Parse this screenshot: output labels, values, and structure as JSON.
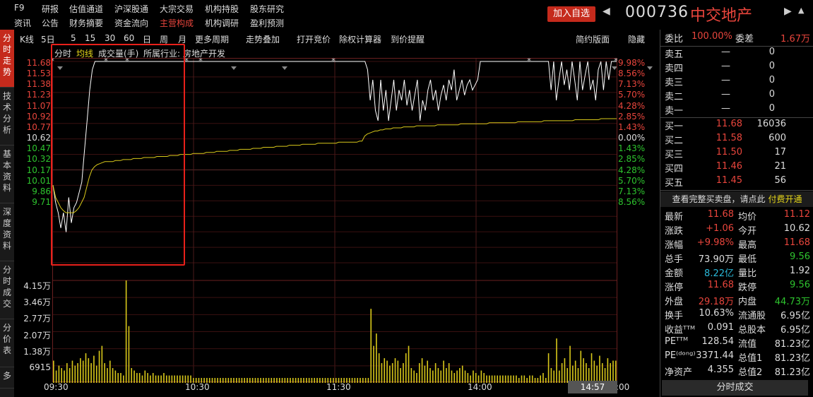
{
  "topnav": {
    "row1": [
      "F9",
      "研报",
      "估值通道",
      "沪深股通",
      "大宗交易",
      "机构持股",
      "股东研究"
    ],
    "row2": [
      "资讯",
      "公告",
      "财务摘要",
      "资金流向",
      "主营构成",
      "机构调研",
      "盈利预测"
    ],
    "active": "主营构成"
  },
  "header": {
    "add_watch": "加入自选",
    "code": "000736",
    "name": "中交地产"
  },
  "lefttabs": [
    "分时走势",
    "技术分析",
    "基本资料",
    "深度资料",
    "分时成交",
    "分价表",
    "多"
  ],
  "toolbar": {
    "items": [
      "K线",
      "5日",
      "5",
      "15",
      "30",
      "60",
      "日",
      "周",
      "月",
      "更多周期",
      "走势叠加",
      "打开竞价",
      "除权计算器",
      "到价提醒"
    ],
    "right": [
      "简约版面",
      "隐藏"
    ]
  },
  "subtabs": [
    "分时",
    "均线",
    "成交量(手)",
    "所属行业:",
    "房地产开发"
  ],
  "price_axis": {
    "left": [
      {
        "v": "11.68",
        "c": "red"
      },
      {
        "v": "11.53",
        "c": "red"
      },
      {
        "v": "11.38",
        "c": "red"
      },
      {
        "v": "11.23",
        "c": "red"
      },
      {
        "v": "11.07",
        "c": "red"
      },
      {
        "v": "10.92",
        "c": "red"
      },
      {
        "v": "10.77",
        "c": "red"
      },
      {
        "v": "10.62",
        "c": "white"
      },
      {
        "v": "10.47",
        "c": "green"
      },
      {
        "v": "10.32",
        "c": "green"
      },
      {
        "v": "10.17",
        "c": "green"
      },
      {
        "v": "10.01",
        "c": "green"
      },
      {
        "v": "9.86",
        "c": "green"
      },
      {
        "v": "9.71",
        "c": "green"
      }
    ],
    "right": [
      {
        "v": "9.98%",
        "c": "red"
      },
      {
        "v": "8.56%",
        "c": "red"
      },
      {
        "v": "7.13%",
        "c": "red"
      },
      {
        "v": "5.70%",
        "c": "red"
      },
      {
        "v": "4.28%",
        "c": "red"
      },
      {
        "v": "2.85%",
        "c": "red"
      },
      {
        "v": "1.43%",
        "c": "red"
      },
      {
        "v": "0.00%",
        "c": "white"
      },
      {
        "v": "1.43%",
        "c": "green"
      },
      {
        "v": "2.85%",
        "c": "green"
      },
      {
        "v": "4.28%",
        "c": "green"
      },
      {
        "v": "5.70%",
        "c": "green"
      },
      {
        "v": "7.13%",
        "c": "green"
      },
      {
        "v": "8.56%",
        "c": "green"
      }
    ]
  },
  "volume_axis": [
    "4.15万",
    "3.46万",
    "2.77万",
    "2.07万",
    "1.38万",
    "6915"
  ],
  "time_axis": [
    "09:30",
    "10:30",
    "11:30",
    "14:00",
    ":00"
  ],
  "time_badge": "14:57",
  "chart_data": {
    "type": "line",
    "series": [],
    "ylim": [
      9.71,
      11.68
    ],
    "price_line": [
      10.47,
      10.3,
      10.2,
      10.05,
      10.2,
      10.01,
      10.35,
      10.1,
      10.25,
      10.3,
      10.4,
      10.5,
      10.8,
      11.1,
      11.4,
      11.6,
      11.68,
      11.68,
      11.68,
      11.68,
      11.68,
      11.68,
      11.68,
      11.68,
      11.68,
      11.68,
      11.68,
      11.68,
      11.68,
      11.68,
      11.68,
      11.68,
      11.68,
      11.68,
      11.68,
      11.68,
      11.68,
      11.68,
      11.68,
      11.68,
      11.68,
      11.68,
      11.68,
      11.68,
      11.68,
      11.68,
      11.68,
      11.68,
      11.68,
      11.68,
      11.68,
      11.68,
      11.68,
      11.68,
      11.68,
      11.68,
      11.68,
      11.68,
      11.68,
      11.68,
      11.68,
      11.68,
      11.68,
      11.68,
      11.68,
      11.68,
      11.68,
      11.68,
      11.68,
      11.68,
      11.68,
      11.68,
      11.68,
      11.68,
      11.68,
      11.68,
      11.68,
      11.68,
      11.68,
      11.68,
      11.68,
      11.68,
      11.68,
      11.68,
      11.68,
      11.68,
      11.68,
      11.68,
      11.68,
      11.68,
      11.68,
      11.68,
      11.68,
      11.68,
      11.68,
      11.68,
      11.68,
      11.68,
      11.68,
      11.68,
      11.68,
      11.68,
      11.68,
      11.68,
      11.68,
      11.68,
      11.68,
      11.68,
      11.68,
      11.68,
      11.68,
      11.68,
      11.68,
      11.68,
      11.68,
      11.68,
      11.68,
      11.68,
      11.68,
      11.68,
      11.6,
      11.3,
      11.5,
      11.2,
      11.1,
      11.5,
      11.2,
      11.4,
      11.1,
      11.3,
      11.5,
      11.2,
      11.4,
      11.3,
      11.5,
      11.25,
      11.4,
      11.2,
      11.35,
      11.5,
      11.1,
      11.3,
      11.2,
      11.4,
      11.5,
      11.3,
      11.4,
      11.2,
      11.35,
      11.45,
      11.3,
      11.5,
      11.4,
      11.6,
      11.3,
      11.4,
      11.5,
      11.35,
      11.45,
      11.5,
      11.4,
      11.45,
      11.5,
      11.68,
      11.68,
      11.68,
      11.68,
      11.68,
      11.68,
      11.68,
      11.68,
      11.68,
      11.68,
      11.68,
      11.68,
      11.68,
      11.68,
      11.68,
      11.68,
      11.68,
      11.68,
      11.68,
      11.68,
      11.68,
      11.68,
      11.68,
      11.68,
      11.68,
      11.68,
      11.68,
      11.4,
      11.68,
      11.3,
      11.5,
      11.68,
      11.45,
      11.6,
      11.4,
      11.68,
      11.5,
      11.3,
      11.68,
      11.4,
      11.55,
      11.68,
      11.4,
      11.5,
      11.3,
      11.6,
      11.68,
      11.4,
      11.68,
      11.5,
      11.68,
      11.68,
      11.68
    ],
    "avg_line": [
      10.47,
      10.35,
      10.3,
      10.25,
      10.22,
      10.2,
      10.2,
      10.2,
      10.2,
      10.22,
      10.25,
      10.3,
      10.35,
      10.45,
      10.55,
      10.62,
      10.65,
      10.67,
      10.68,
      10.69,
      10.7,
      10.7,
      10.7,
      10.7,
      10.71,
      10.71,
      10.71,
      10.72,
      10.72,
      10.72,
      10.72,
      10.73,
      10.73,
      10.73,
      10.73,
      10.74,
      10.74,
      10.74,
      10.74,
      10.74,
      10.75,
      10.75,
      10.75,
      10.75,
      10.75,
      10.76,
      10.76,
      10.76,
      10.76,
      10.77,
      10.77,
      10.77,
      10.77,
      10.77,
      10.78,
      10.78,
      10.78,
      10.78,
      10.78,
      10.79,
      10.79,
      10.79,
      10.79,
      10.8,
      10.8,
      10.8,
      10.8,
      10.8,
      10.81,
      10.81,
      10.81,
      10.81,
      10.82,
      10.82,
      10.82,
      10.82,
      10.82,
      10.83,
      10.83,
      10.83,
      10.83,
      10.84,
      10.84,
      10.84,
      10.84,
      10.84,
      10.85,
      10.85,
      10.85,
      10.85,
      10.85,
      10.86,
      10.86,
      10.86,
      10.86,
      10.86,
      10.87,
      10.87,
      10.87,
      10.87,
      10.87,
      10.87,
      10.88,
      10.88,
      10.88,
      10.88,
      10.88,
      10.88,
      10.88,
      10.88,
      10.89,
      10.89,
      10.89,
      10.89,
      10.89,
      10.89,
      10.89,
      10.89,
      10.9,
      10.9,
      10.95,
      10.97,
      10.98,
      10.99,
      11.0,
      11.0,
      11.01,
      11.01,
      11.02,
      11.02,
      11.02,
      11.03,
      11.03,
      11.03,
      11.03,
      11.04,
      11.04,
      11.04,
      11.04,
      11.04,
      11.05,
      11.05,
      11.05,
      11.05,
      11.05,
      11.05,
      11.05,
      11.05,
      11.06,
      11.06,
      11.06,
      11.06,
      11.06,
      11.06,
      11.06,
      11.06,
      11.06,
      11.07,
      11.07,
      11.07,
      11.07,
      11.07,
      11.07,
      11.07,
      11.07,
      11.07,
      11.07,
      11.07,
      11.08,
      11.08,
      11.08,
      11.08,
      11.08,
      11.08,
      11.08,
      11.08,
      11.08,
      11.08,
      11.08,
      11.09,
      11.09,
      11.09,
      11.09,
      11.09,
      11.09,
      11.09,
      11.09,
      11.09,
      11.09,
      11.1,
      11.1,
      11.1,
      11.1,
      11.1,
      11.1,
      11.1,
      11.1,
      11.1,
      11.1,
      11.1,
      11.1,
      11.11,
      11.11,
      11.11,
      11.11,
      11.11,
      11.11,
      11.11,
      11.11,
      11.11,
      11.11,
      11.12,
      11.12,
      11.12,
      11.12,
      11.12,
      11.12,
      11.12
    ],
    "volume": [
      0.9,
      0.5,
      0.7,
      0.6,
      0.5,
      0.8,
      0.6,
      0.9,
      0.7,
      0.8,
      1.0,
      0.9,
      1.2,
      1.0,
      0.8,
      1.1,
      0.7,
      1.3,
      1.5,
      0.8,
      0.6,
      0.9,
      0.6,
      0.5,
      0.4,
      0.4,
      0.3,
      4.15,
      2.3,
      0.6,
      0.5,
      0.4,
      0.4,
      0.3,
      0.5,
      0.4,
      0.3,
      0.4,
      0.3,
      0.3,
      0.3,
      0.4,
      0.3,
      0.3,
      0.3,
      0.3,
      0.3,
      0.3,
      0.3,
      0.3,
      0.3,
      0.3,
      0.2,
      0.2,
      0.2,
      0.2,
      0.2,
      0.2,
      0.2,
      0.2,
      0.2,
      0.2,
      0.2,
      0.2,
      0.2,
      0.2,
      0.2,
      0.2,
      0.2,
      0.2,
      0.2,
      0.2,
      0.2,
      0.2,
      0.2,
      0.2,
      0.2,
      0.2,
      0.2,
      0.2,
      0.2,
      0.2,
      0.2,
      0.2,
      0.2,
      0.2,
      0.2,
      0.2,
      0.2,
      0.2,
      0.2,
      0.2,
      0.2,
      0.2,
      0.2,
      0.2,
      0.2,
      0.2,
      0.2,
      0.2,
      0.2,
      0.2,
      0.2,
      0.2,
      0.2,
      0.2,
      0.2,
      0.2,
      0.2,
      0.2,
      0.2,
      0.2,
      0.2,
      0.2,
      0.2,
      0.2,
      0.2,
      0.2,
      3.0,
      1.5,
      2.0,
      1.2,
      0.8,
      1.0,
      0.9,
      0.7,
      0.8,
      1.0,
      0.9,
      0.6,
      0.8,
      1.2,
      1.5,
      0.6,
      0.5,
      0.4,
      0.8,
      1.0,
      0.7,
      0.9,
      0.6,
      0.5,
      0.8,
      0.6,
      0.5,
      0.9,
      0.6,
      0.8,
      0.5,
      0.4,
      0.5,
      0.6,
      0.7,
      0.5,
      0.4,
      0.3,
      0.5,
      0.4,
      0.3,
      0.5,
      0.4,
      0.3,
      0.3,
      0.3,
      0.3,
      0.3,
      0.3,
      0.3,
      0.3,
      0.3,
      0.3,
      0.3,
      0.3,
      0.2,
      0.3,
      0.3,
      0.2,
      0.3,
      0.3,
      0.2,
      0.2,
      0.3,
      0.4,
      0.2,
      1.2,
      0.6,
      0.5,
      1.8,
      0.5,
      0.8,
      1.0,
      0.6,
      1.5,
      0.7,
      0.9,
      0.6,
      1.3,
      1.0,
      0.8,
      0.6,
      1.2,
      0.9,
      0.7,
      1.1,
      0.8,
      0.6,
      1.0,
      0.8,
      0.9,
      0.9
    ]
  },
  "quote": {
    "weibi_label": "委比",
    "weibi": "100.00%",
    "weicha_label": "委差",
    "weicha": "1.67万",
    "sells": [
      {
        "l": "卖五",
        "p": "—",
        "v": "0"
      },
      {
        "l": "卖四",
        "p": "—",
        "v": "0"
      },
      {
        "l": "卖三",
        "p": "—",
        "v": "0"
      },
      {
        "l": "卖二",
        "p": "—",
        "v": "0"
      },
      {
        "l": "卖一",
        "p": "—",
        "v": "0"
      }
    ],
    "buys": [
      {
        "l": "买一",
        "p": "11.68",
        "v": "16036"
      },
      {
        "l": "买二",
        "p": "11.58",
        "v": "600"
      },
      {
        "l": "买三",
        "p": "11.50",
        "v": "17"
      },
      {
        "l": "买四",
        "p": "11.46",
        "v": "21"
      },
      {
        "l": "买五",
        "p": "11.45",
        "v": "56"
      }
    ],
    "promo_text": "查看完整买卖盘，请点此",
    "promo_link": "付费开通",
    "stats": [
      {
        "a": "最新",
        "av": "11.68",
        "ac": "red",
        "b": "均价",
        "bv": "11.12",
        "bc": "red"
      },
      {
        "a": "涨跌",
        "av": "+1.06",
        "ac": "red",
        "b": "今开",
        "bv": "10.62",
        "bc": "white"
      },
      {
        "a": "涨幅",
        "av": "+9.98%",
        "ac": "red",
        "b": "最高",
        "bv": "11.68",
        "bc": "red"
      },
      {
        "a": "总手",
        "av": "73.90万",
        "ac": "white",
        "b": "最低",
        "bv": "9.56",
        "bc": "green"
      },
      {
        "a": "金额",
        "av": "8.22亿",
        "ac": "cyan",
        "b": "量比",
        "bv": "1.92",
        "bc": "white"
      },
      {
        "a": "涨停",
        "av": "11.68",
        "ac": "red",
        "b": "跌停",
        "bv": "9.56",
        "bc": "green"
      },
      {
        "a": "外盘",
        "av": "29.18万",
        "ac": "red",
        "b": "内盘",
        "bv": "44.73万",
        "bc": "green"
      },
      {
        "a": "换手",
        "av": "10.63%",
        "ac": "white",
        "b": "流通股",
        "bv": "6.95亿",
        "bc": "white"
      },
      {
        "a": "收益ᵀᵀᴹ",
        "av": "0.091",
        "ac": "white",
        "b": "总股本",
        "bv": "6.95亿",
        "bc": "white"
      },
      {
        "a": "PEᵀᵀᴹ",
        "av": "128.54",
        "ac": "white",
        "b": "流值",
        "bv": "81.23亿",
        "bc": "white"
      },
      {
        "a": "PE⁽ᵈᵒⁿᵍ⁾",
        "av": "3371.44",
        "ac": "white",
        "b": "总值1",
        "bv": "81.23亿",
        "bc": "white"
      },
      {
        "a": "净资产",
        "av": "4.355",
        "ac": "white",
        "b": "总值2",
        "bv": "81.23亿",
        "bc": "white"
      }
    ],
    "footer": "分时成交"
  },
  "colors": {
    "up": "#e8453c",
    "down": "#2ec42e",
    "price_line": "#ffffff",
    "avg_line": "#d8c81a",
    "volume": "#d8c81a",
    "grid": "#3a1010"
  }
}
